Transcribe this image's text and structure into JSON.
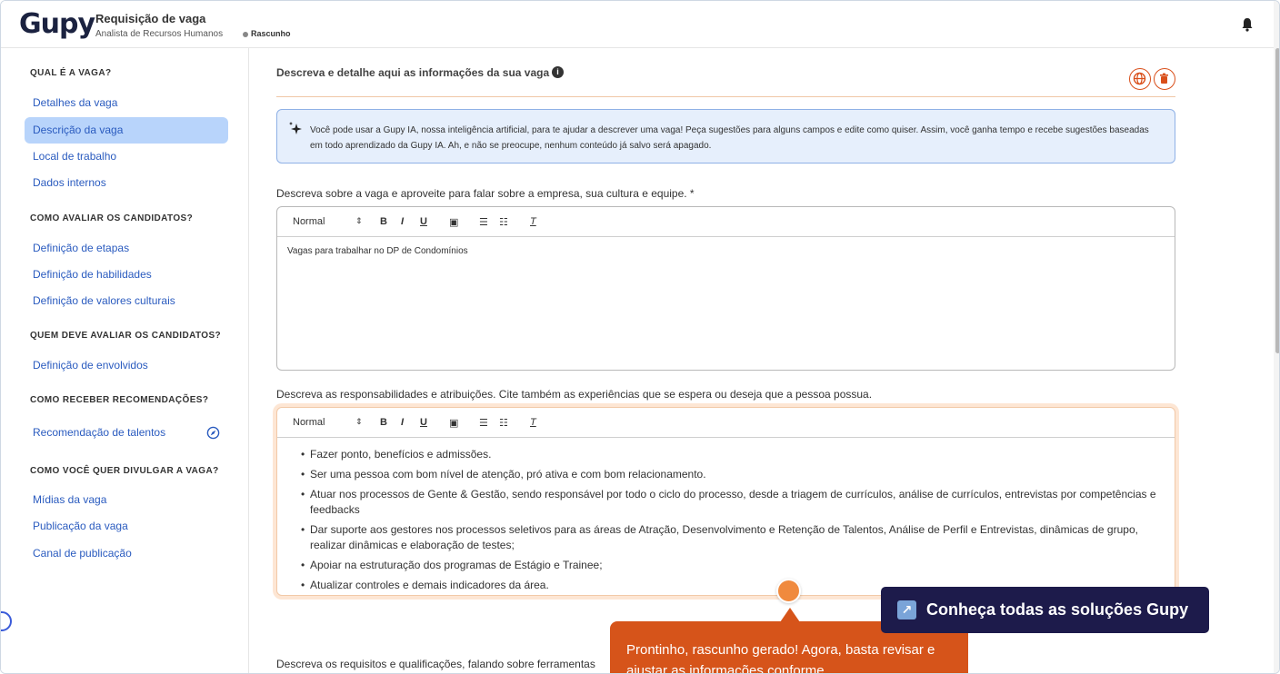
{
  "header": {
    "logo": "Gupy",
    "title": "Requisição de vaga",
    "subtitle": "Analista de Recursos Humanos",
    "status": "Rascunho"
  },
  "sidebar": {
    "sections": [
      {
        "heading": "QUAL É A VAGA?",
        "items": [
          "Detalhes da vaga",
          "Descrição da vaga",
          "Local de trabalho",
          "Dados internos"
        ]
      },
      {
        "heading": "COMO AVALIAR OS CANDIDATOS?",
        "items": [
          "Definição de etapas",
          "Definição de habilidades",
          "Definição de valores culturais"
        ]
      },
      {
        "heading": "QUEM DEVE AVALIAR OS CANDIDATOS?",
        "items": [
          "Definição de envolvidos"
        ]
      },
      {
        "heading": "COMO RECEBER RECOMENDAÇÕES?",
        "items": [
          "Recomendação de talentos"
        ]
      },
      {
        "heading": "COMO VOCÊ QUER DIVULGAR A VAGA?",
        "items": [
          "Mídias da vaga",
          "Publicação da vaga",
          "Canal de publicação"
        ]
      }
    ],
    "active": "Descrição da vaga"
  },
  "main": {
    "title": "Descreva e detalhe aqui as informações da sua vaga",
    "ai_notice": "Você pode usar a Gupy IA, nossa inteligência artificial, para te ajudar a descrever uma vaga! Peça sugestões para alguns campos e edite como quiser. Assim, você ganha tempo e recebe sugestões baseadas em todo aprendizado da Gupy IA. Ah, e não se preocupe, nenhum conteúdo já salvo será apagado.",
    "field1_label": "Descreva sobre a vaga e aproveite para falar sobre a empresa, sua cultura e equipe. *",
    "field1_value": "Vagas para trabalhar no DP de Condomínios",
    "field2_label": "Descreva as responsabilidades e atribuições. Cite também as experiências que se espera ou deseja que a pessoa possua.",
    "field2_items": [
      "Fazer ponto, benefícios e admissões.",
      "Ser uma pessoa com bom nível de atenção, pró ativa e com bom relacionamento.",
      "Atuar nos processos de Gente & Gestão, sendo responsável por todo o ciclo do processo, desde a triagem de currículos, análise de currículos, entrevistas por competências e feedbacks",
      "Dar suporte aos gestores nos processos seletivos para as áreas de Atração, Desenvolvimento e Retenção de Talentos, Análise de Perfil e Entrevistas, dinâmicas de grupo, realizar dinâmicas e elaboração de testes;",
      "Apoiar na estruturação dos programas de Estágio e Trainee;",
      "Atualizar controles e demais indicadores da área."
    ],
    "field3_label": "Descreva os requisitos e qualificações, falando sobre ferramentas",
    "toolbar_format": "Normal"
  },
  "popup_text": "Prontinho, rascunho gerado! Agora, basta revisar e ajustar as informações conforme",
  "banner_text": "Conheça todas as soluções Gupy",
  "colors": {
    "accent": "#d6541a",
    "link": "#2a5bbf",
    "active_bg": "#b8d4fb",
    "banner": "#1d1b4b"
  }
}
